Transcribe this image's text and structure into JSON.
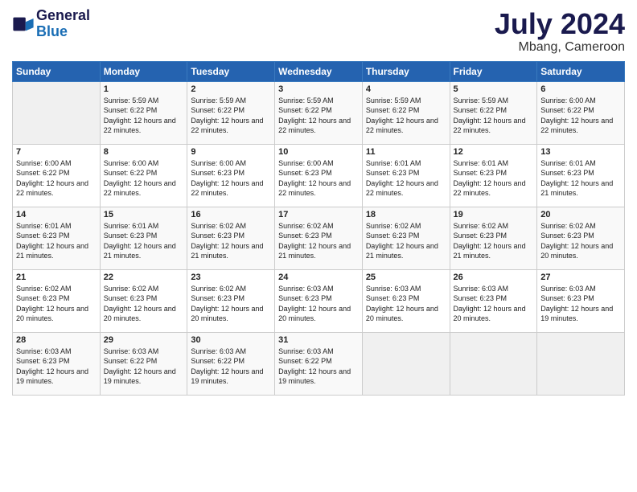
{
  "header": {
    "logo_line1": "General",
    "logo_line2": "Blue",
    "month_year": "July 2024",
    "location": "Mbang, Cameroon"
  },
  "days_of_week": [
    "Sunday",
    "Monday",
    "Tuesday",
    "Wednesday",
    "Thursday",
    "Friday",
    "Saturday"
  ],
  "weeks": [
    [
      {
        "day": "",
        "sunrise": "",
        "sunset": "",
        "daylight": ""
      },
      {
        "day": "1",
        "sunrise": "Sunrise: 5:59 AM",
        "sunset": "Sunset: 6:22 PM",
        "daylight": "Daylight: 12 hours and 22 minutes."
      },
      {
        "day": "2",
        "sunrise": "Sunrise: 5:59 AM",
        "sunset": "Sunset: 6:22 PM",
        "daylight": "Daylight: 12 hours and 22 minutes."
      },
      {
        "day": "3",
        "sunrise": "Sunrise: 5:59 AM",
        "sunset": "Sunset: 6:22 PM",
        "daylight": "Daylight: 12 hours and 22 minutes."
      },
      {
        "day": "4",
        "sunrise": "Sunrise: 5:59 AM",
        "sunset": "Sunset: 6:22 PM",
        "daylight": "Daylight: 12 hours and 22 minutes."
      },
      {
        "day": "5",
        "sunrise": "Sunrise: 5:59 AM",
        "sunset": "Sunset: 6:22 PM",
        "daylight": "Daylight: 12 hours and 22 minutes."
      },
      {
        "day": "6",
        "sunrise": "Sunrise: 6:00 AM",
        "sunset": "Sunset: 6:22 PM",
        "daylight": "Daylight: 12 hours and 22 minutes."
      }
    ],
    [
      {
        "day": "7",
        "sunrise": "Sunrise: 6:00 AM",
        "sunset": "Sunset: 6:22 PM",
        "daylight": "Daylight: 12 hours and 22 minutes."
      },
      {
        "day": "8",
        "sunrise": "Sunrise: 6:00 AM",
        "sunset": "Sunset: 6:22 PM",
        "daylight": "Daylight: 12 hours and 22 minutes."
      },
      {
        "day": "9",
        "sunrise": "Sunrise: 6:00 AM",
        "sunset": "Sunset: 6:23 PM",
        "daylight": "Daylight: 12 hours and 22 minutes."
      },
      {
        "day": "10",
        "sunrise": "Sunrise: 6:00 AM",
        "sunset": "Sunset: 6:23 PM",
        "daylight": "Daylight: 12 hours and 22 minutes."
      },
      {
        "day": "11",
        "sunrise": "Sunrise: 6:01 AM",
        "sunset": "Sunset: 6:23 PM",
        "daylight": "Daylight: 12 hours and 22 minutes."
      },
      {
        "day": "12",
        "sunrise": "Sunrise: 6:01 AM",
        "sunset": "Sunset: 6:23 PM",
        "daylight": "Daylight: 12 hours and 22 minutes."
      },
      {
        "day": "13",
        "sunrise": "Sunrise: 6:01 AM",
        "sunset": "Sunset: 6:23 PM",
        "daylight": "Daylight: 12 hours and 21 minutes."
      }
    ],
    [
      {
        "day": "14",
        "sunrise": "Sunrise: 6:01 AM",
        "sunset": "Sunset: 6:23 PM",
        "daylight": "Daylight: 12 hours and 21 minutes."
      },
      {
        "day": "15",
        "sunrise": "Sunrise: 6:01 AM",
        "sunset": "Sunset: 6:23 PM",
        "daylight": "Daylight: 12 hours and 21 minutes."
      },
      {
        "day": "16",
        "sunrise": "Sunrise: 6:02 AM",
        "sunset": "Sunset: 6:23 PM",
        "daylight": "Daylight: 12 hours and 21 minutes."
      },
      {
        "day": "17",
        "sunrise": "Sunrise: 6:02 AM",
        "sunset": "Sunset: 6:23 PM",
        "daylight": "Daylight: 12 hours and 21 minutes."
      },
      {
        "day": "18",
        "sunrise": "Sunrise: 6:02 AM",
        "sunset": "Sunset: 6:23 PM",
        "daylight": "Daylight: 12 hours and 21 minutes."
      },
      {
        "day": "19",
        "sunrise": "Sunrise: 6:02 AM",
        "sunset": "Sunset: 6:23 PM",
        "daylight": "Daylight: 12 hours and 21 minutes."
      },
      {
        "day": "20",
        "sunrise": "Sunrise: 6:02 AM",
        "sunset": "Sunset: 6:23 PM",
        "daylight": "Daylight: 12 hours and 20 minutes."
      }
    ],
    [
      {
        "day": "21",
        "sunrise": "Sunrise: 6:02 AM",
        "sunset": "Sunset: 6:23 PM",
        "daylight": "Daylight: 12 hours and 20 minutes."
      },
      {
        "day": "22",
        "sunrise": "Sunrise: 6:02 AM",
        "sunset": "Sunset: 6:23 PM",
        "daylight": "Daylight: 12 hours and 20 minutes."
      },
      {
        "day": "23",
        "sunrise": "Sunrise: 6:02 AM",
        "sunset": "Sunset: 6:23 PM",
        "daylight": "Daylight: 12 hours and 20 minutes."
      },
      {
        "day": "24",
        "sunrise": "Sunrise: 6:03 AM",
        "sunset": "Sunset: 6:23 PM",
        "daylight": "Daylight: 12 hours and 20 minutes."
      },
      {
        "day": "25",
        "sunrise": "Sunrise: 6:03 AM",
        "sunset": "Sunset: 6:23 PM",
        "daylight": "Daylight: 12 hours and 20 minutes."
      },
      {
        "day": "26",
        "sunrise": "Sunrise: 6:03 AM",
        "sunset": "Sunset: 6:23 PM",
        "daylight": "Daylight: 12 hours and 20 minutes."
      },
      {
        "day": "27",
        "sunrise": "Sunrise: 6:03 AM",
        "sunset": "Sunset: 6:23 PM",
        "daylight": "Daylight: 12 hours and 19 minutes."
      }
    ],
    [
      {
        "day": "28",
        "sunrise": "Sunrise: 6:03 AM",
        "sunset": "Sunset: 6:23 PM",
        "daylight": "Daylight: 12 hours and 19 minutes."
      },
      {
        "day": "29",
        "sunrise": "Sunrise: 6:03 AM",
        "sunset": "Sunset: 6:22 PM",
        "daylight": "Daylight: 12 hours and 19 minutes."
      },
      {
        "day": "30",
        "sunrise": "Sunrise: 6:03 AM",
        "sunset": "Sunset: 6:22 PM",
        "daylight": "Daylight: 12 hours and 19 minutes."
      },
      {
        "day": "31",
        "sunrise": "Sunrise: 6:03 AM",
        "sunset": "Sunset: 6:22 PM",
        "daylight": "Daylight: 12 hours and 19 minutes."
      },
      {
        "day": "",
        "sunrise": "",
        "sunset": "",
        "daylight": ""
      },
      {
        "day": "",
        "sunrise": "",
        "sunset": "",
        "daylight": ""
      },
      {
        "day": "",
        "sunrise": "",
        "sunset": "",
        "daylight": ""
      }
    ]
  ]
}
